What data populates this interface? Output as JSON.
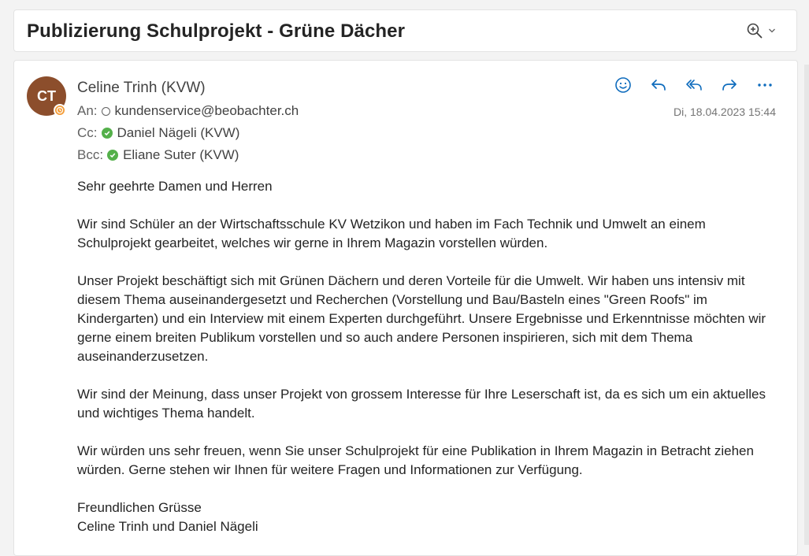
{
  "subject": "Publizierung Schulprojekt - Grüne Dächer",
  "sender": {
    "initials": "CT",
    "name": "Celine Trinh (KVW)"
  },
  "recipients": {
    "to_label": "An:",
    "to": "kundenservice@beobachter.ch",
    "cc_label": "Cc:",
    "cc": "Daniel Nägeli (KVW)",
    "bcc_label": "Bcc:",
    "bcc": "Eliane Suter (KVW)"
  },
  "date": "Di, 18.04.2023 15:44",
  "colors": {
    "accent": "#0f6cbd",
    "avatar": "#8c4e2c",
    "presence_away": "#f39c38",
    "status_ok": "#54b04a"
  },
  "icons": {
    "zoom": "zoom-in-icon",
    "emoji": "emoji-icon",
    "reply": "reply-icon",
    "reply_all": "reply-all-icon",
    "forward": "forward-icon",
    "more": "more-icon"
  },
  "body": {
    "greeting": "Sehr geehrte Damen und Herren",
    "p1": "Wir sind Schüler an der Wirtschaftsschule KV Wetzikon und haben im Fach Technik und Umwelt an einem Schulprojekt gearbeitet, welches wir gerne in Ihrem Magazin vorstellen würden.",
    "p2": "Unser Projekt beschäftigt sich mit Grünen Dächern und deren Vorteile für die Umwelt. Wir haben uns intensiv mit diesem Thema auseinandergesetzt und Recherchen (Vorstellung und Bau/Basteln eines \"Green Roofs\" im Kindergarten) und ein Interview mit einem Experten durchgeführt. Unsere Ergebnisse und Erkenntnisse möchten wir gerne einem breiten Publikum vorstellen und so auch andere Personen inspirieren, sich mit dem Thema auseinanderzusetzen.",
    "p3": "Wir sind der Meinung, dass unser Projekt von grossem Interesse für Ihre Leserschaft ist, da es sich um ein aktuelles und wichtiges Thema handelt.",
    "p4": "Wir würden uns sehr freuen, wenn Sie unser Schulprojekt für eine Publikation in Ihrem Magazin in Betracht ziehen würden. Gerne stehen wir Ihnen für weitere Fragen und Informationen zur Verfügung.",
    "closing": "Freundlichen Grüsse",
    "signature": "Celine Trinh und Daniel Nägeli"
  }
}
